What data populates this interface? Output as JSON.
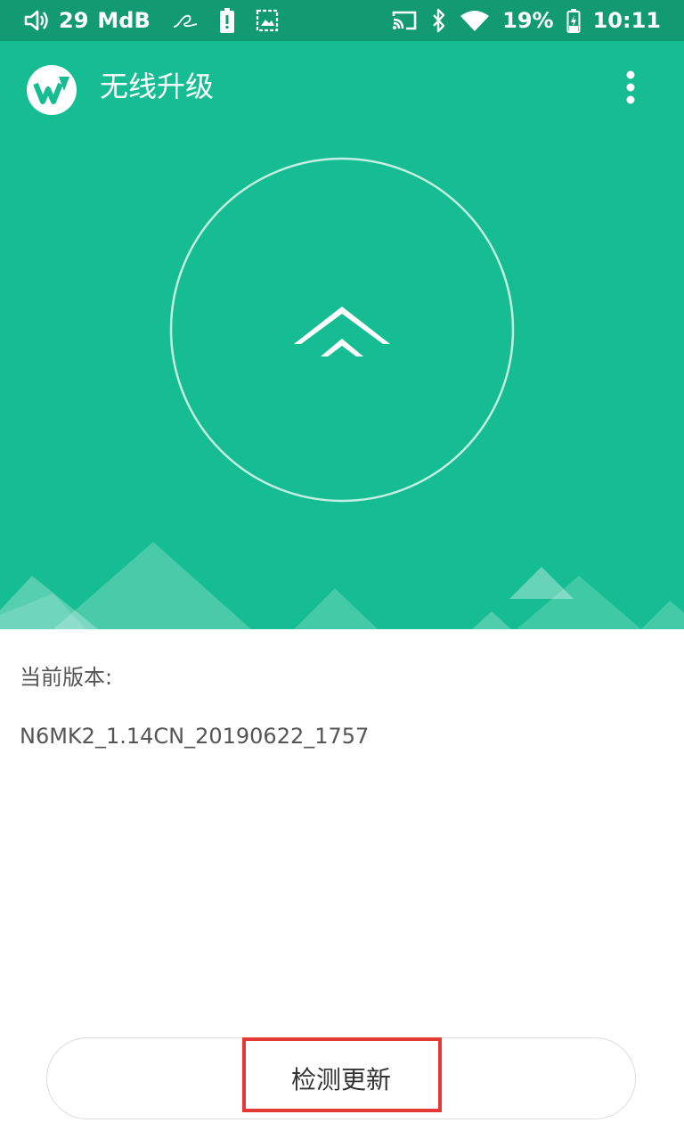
{
  "status_bar": {
    "volume_level": "29",
    "volume_unit": "MdB",
    "battery_percent": "19%",
    "time": "10:11",
    "icons": [
      "volume-icon",
      "signature-icon",
      "battery-alert-icon",
      "screenshot-icon",
      "cast-icon",
      "bluetooth-icon",
      "wifi-icon",
      "battery-icon"
    ]
  },
  "app_bar": {
    "title": "无线升级",
    "logo_icon": "app-logo-icon",
    "menu_icon": "more-vert-icon"
  },
  "hero": {
    "icon": "double-chevron-up-icon",
    "background_color": "#16bd92"
  },
  "version": {
    "label": "当前版本:",
    "value": "N6MK2_1.14CN_20190622_1757"
  },
  "actions": {
    "check_update_label": "检测更新"
  },
  "colors": {
    "status_bar": "#129a73",
    "accent": "#16bd92",
    "highlight": "#e53935"
  }
}
